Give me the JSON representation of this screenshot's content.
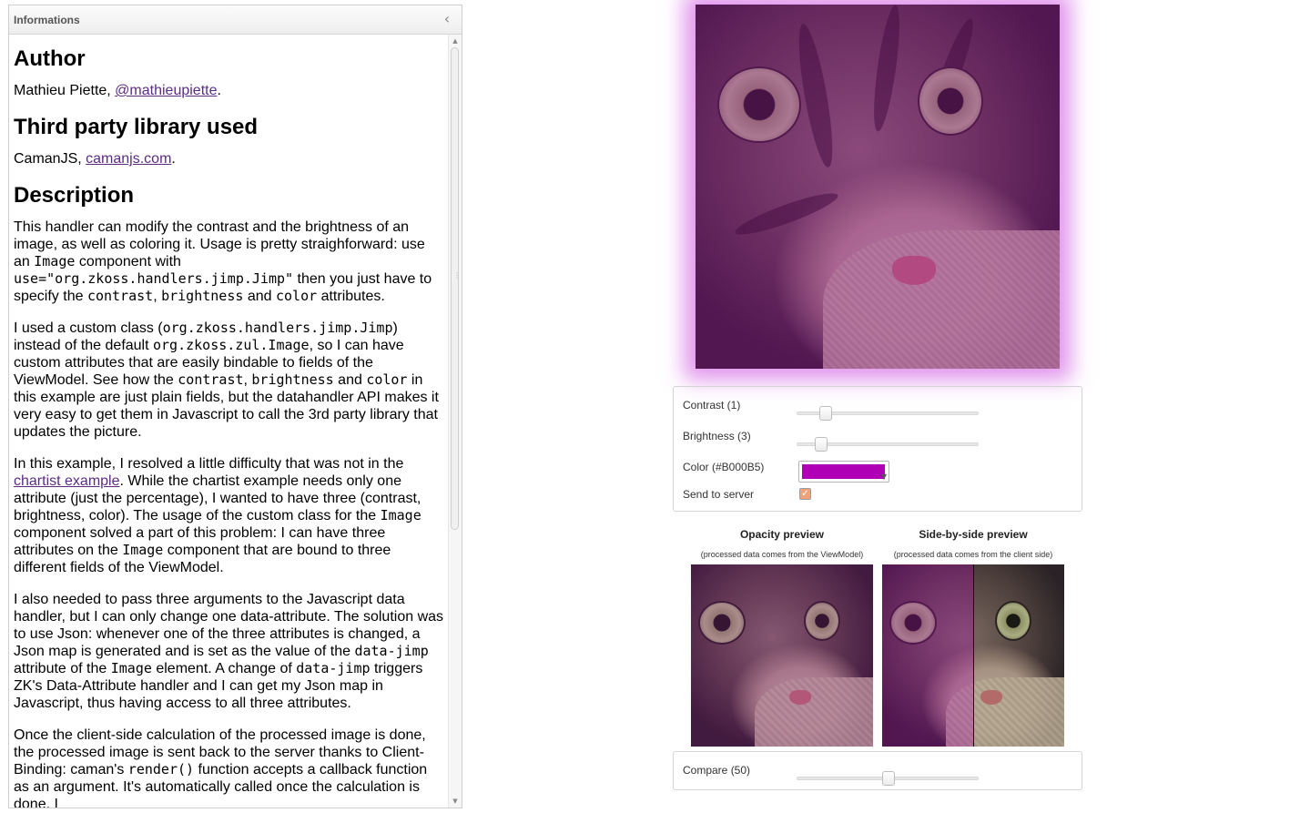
{
  "panel": {
    "title": "Informations",
    "collapse_icon": "chevron-left-icon",
    "author_heading": "Author",
    "author_name": "Mathieu Piette, ",
    "author_link": "@mathieupiette",
    "author_end": ".",
    "library_heading": "Third party library used",
    "library_name": "CamanJS, ",
    "library_link": "camanjs.com",
    "library_end": ".",
    "description_heading": "Description",
    "p1": {
      "t1": "This handler can modify the contrast and the brightness of an image, as well as coloring it. Usage is pretty straighforward: use an ",
      "c1": "Image",
      "t2": " component with ",
      "c2": "use=\"org.zkoss.handlers.jimp.Jimp\"",
      "t3": " then you just have to specify the ",
      "c3": "contrast",
      "t4": ", ",
      "c4": "brightness",
      "t5": " and ",
      "c5": "color",
      "t6": " attributes."
    },
    "p2": {
      "t1": "I used a custom class (",
      "c1": "org.zkoss.handlers.jimp.Jimp",
      "t2": ") instead of the default ",
      "c2": "org.zkoss.zul.Image",
      "t3": ", so I can have custom attributes that are easily bindable to fields of the ViewModel. See how the ",
      "c3": "contrast",
      "t4": ", ",
      "c4": "brightness",
      "t5": " and ",
      "c5": "color",
      "t6": " in this example are just plain fields, but the datahandler API makes it very easy to get them in Javascript to call the 3rd party library that updates the picture."
    },
    "p3": {
      "t1": "In this example, I resolved a little difficulty that was not in the ",
      "link": "chartist example",
      "t2": ". While the chartist example needs only one attribute (just the percentage), I wanted to have three (contrast, brightness, color). The usage of the custom class for the ",
      "c1": "Image",
      "t3": " component solved a part of this problem: I can have three attributes on the ",
      "c2": "Image",
      "t4": " component that are bound to three different fields of the ViewModel."
    },
    "p4": {
      "t1": "I also needed to pass three arguments to the Javascript data handler, but I can only change one data-attribute. The solution was to use Json: whenever one of the three attributes is changed, a Json map is generated and is set as the value of the ",
      "c1": "data-jimp",
      "t2": " attribute of the ",
      "c2": "Image",
      "t3": " element. A change of ",
      "c3": "data-jimp",
      "t4": " triggers ZK's Data-Attribute handler and I can get my Json map in Javascript, thus having access to all three attributes."
    },
    "p5": {
      "t1": "Once the client-side calculation of the processed image is done, the processed image is sent back to the server thanks to Client-Binding: caman's ",
      "c1": "render()",
      "t2": " function accepts a callback function as an argument. It's automatically called once the calculation is done. I"
    }
  },
  "controls": {
    "contrast_label": "Contrast (1)",
    "contrast_value": 1,
    "contrast_fraction": 0.13,
    "brightness_label": "Brightness (3)",
    "brightness_value": 3,
    "brightness_fraction": 0.1,
    "color_label": "Color (#B000B5)",
    "color_value": "#B000B5",
    "send_label": "Send to server",
    "send_checked": true
  },
  "previews": {
    "opacity_title": "Opacity preview",
    "opacity_sub": "(processed data comes from the ViewModel)",
    "side_title": "Side-by-side preview",
    "side_sub": "(processed data comes from the client side)"
  },
  "compare": {
    "label": "Compare (50)",
    "value": 50,
    "fraction": 0.5
  },
  "colors": {
    "tint": "#B000B5",
    "link": "#5b2c83",
    "glow": "#d66ee6"
  }
}
